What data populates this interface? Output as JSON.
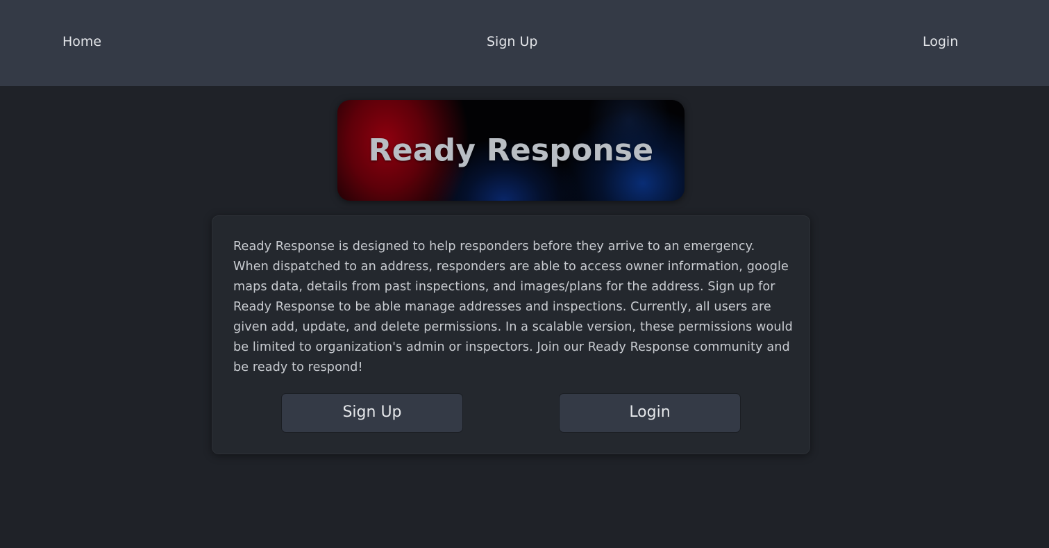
{
  "nav": {
    "home_label": "Home",
    "signup_label": "Sign Up",
    "login_label": "Login"
  },
  "banner": {
    "title": "Ready Response"
  },
  "intro": {
    "description": "Ready Response is designed to help responders before they arrive to an emergency. When dispatched to an address, responders are able to access owner information, google maps data, details from past inspections, and images/plans for the address. Sign up for Ready Response to be able manage addresses and inspections. Currently, all users are given add, update, and delete permissions. In a scalable version, these permissions would be limited to organization's admin or inspectors. Join our Ready Response community and be ready to respond!",
    "signup_button": "Sign Up",
    "login_button": "Login"
  },
  "colors": {
    "navbar_bg": "#343a46",
    "page_bg": "#1f2228",
    "card_bg": "#24282e",
    "button_bg": "#343a46"
  }
}
